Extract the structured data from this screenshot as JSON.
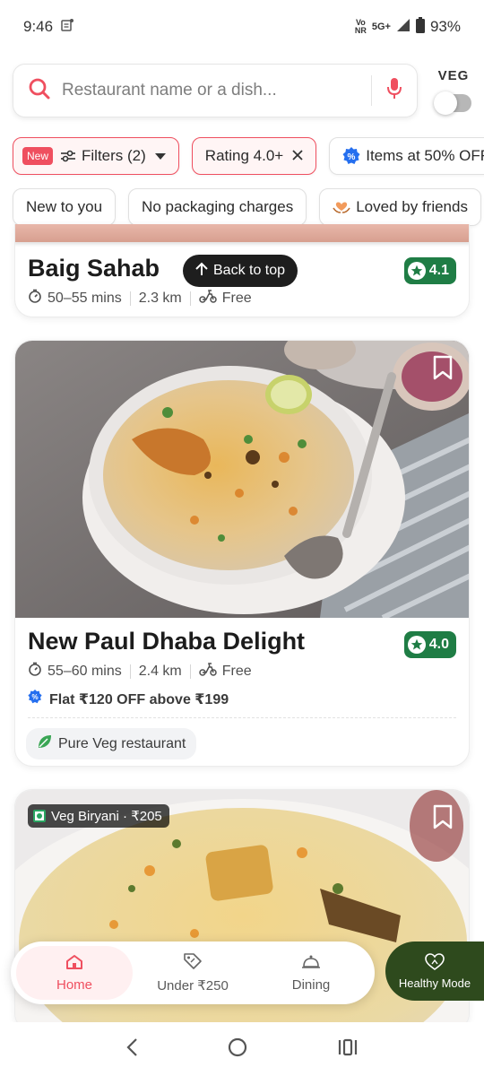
{
  "status_bar": {
    "time": "9:46",
    "network_top": "Vo",
    "network_bottom": "NR",
    "fiveg": "5G+",
    "battery": "93%"
  },
  "search": {
    "placeholder": "Restaurant name or a dish..."
  },
  "veg_toggle": {
    "label": "VEG",
    "on": false
  },
  "filter_chips": [
    {
      "badge": "New",
      "label": "Filters (2)"
    },
    {
      "label": "Rating 4.0+"
    },
    {
      "label": "Items at 50% OFF"
    }
  ],
  "quick_chips": [
    {
      "label": "New to you"
    },
    {
      "label": "No packaging charges"
    },
    {
      "label": "Loved by friends"
    }
  ],
  "back_to_top": "Back to top",
  "restaurants": [
    {
      "name": "Baig Sahab",
      "rating": "4.1",
      "time": "50–55 mins",
      "distance": "2.3 km",
      "delivery": "Free"
    },
    {
      "name": "New Paul Dhaba Delight",
      "rating": "4.0",
      "time": "55–60 mins",
      "distance": "2.4 km",
      "delivery": "Free",
      "offer": "Flat ₹120 OFF above ₹199",
      "tag": "Pure Veg restaurant"
    },
    {
      "dish_tag": "Veg Biryani · ₹205"
    }
  ],
  "bottom_nav": {
    "items": [
      {
        "label": "Home",
        "icon": "home-icon",
        "active": true
      },
      {
        "label": "Under ₹250",
        "icon": "price-tag-icon",
        "active": false
      },
      {
        "label": "Dining",
        "icon": "cloche-icon",
        "active": false
      }
    ],
    "healthy_mode": "Healthy Mode"
  },
  "colors": {
    "accent": "#ef4f5f",
    "rating_green": "#1f7d45",
    "healthy_bg": "#2e4a1d",
    "offer_blue": "#256fef"
  }
}
